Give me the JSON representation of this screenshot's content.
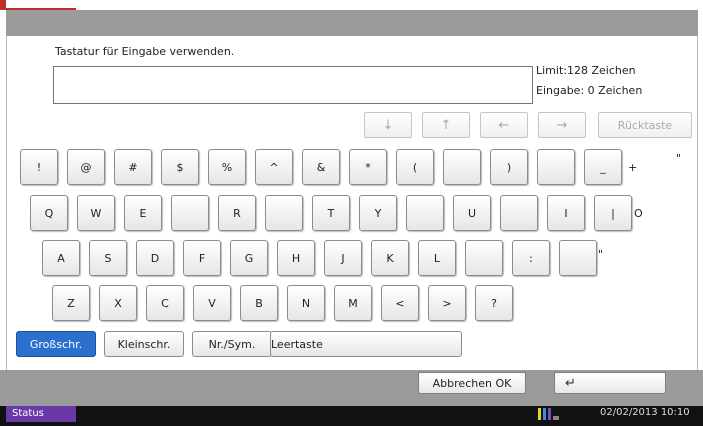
{
  "title_bar": {
    "text": ""
  },
  "instruction": "Tastatur für Eingabe verwenden.",
  "input": {
    "value": ""
  },
  "limit": {
    "label": "Limit:",
    "value": "128",
    "unit": "Zeichen"
  },
  "entry": {
    "label": "Eingabe:",
    "value": "0",
    "unit": "Zeichen"
  },
  "nav_buttons": {
    "down": "↓",
    "up": "↑",
    "left": "←",
    "right": "→",
    "backspace": "Rücktaste"
  },
  "keys": {
    "row1": [
      "!",
      "@",
      "#",
      "$",
      "%",
      "^",
      "&",
      "*",
      "(",
      "",
      ")",
      "",
      "_"
    ],
    "row1_extra": [
      "+",
      "\""
    ],
    "row2": [
      "Q",
      "W",
      "E",
      "",
      "R",
      "",
      "T",
      "Y",
      "",
      "U",
      "",
      "I",
      "|"
    ],
    "row2_extra": [
      "O"
    ],
    "row3": [
      "A",
      "S",
      "D",
      "F",
      "G",
      "H",
      "J",
      "K",
      "L",
      "",
      ":",
      ""
    ],
    "row3_extra": [
      "\""
    ],
    "row4": [
      "Z",
      "X",
      "C",
      "V",
      "B",
      "N",
      "M",
      "<",
      ">",
      "?"
    ]
  },
  "modes": {
    "upper": "Großschr.",
    "lower": "Kleinschr.",
    "numsym": "Nr./Sym.",
    "space": "Leertaste"
  },
  "actions": {
    "cancel_ok": "Abbrechen OK",
    "enter": "↵"
  },
  "status": {
    "button": "Status",
    "datetime": "02/02/2013  10:10"
  },
  "colors": {
    "accent_selected": "#2b6fcf",
    "status_button": "#6a39a8",
    "title_bar": "#9b9b9b",
    "corner_accent": "#c0302a"
  }
}
